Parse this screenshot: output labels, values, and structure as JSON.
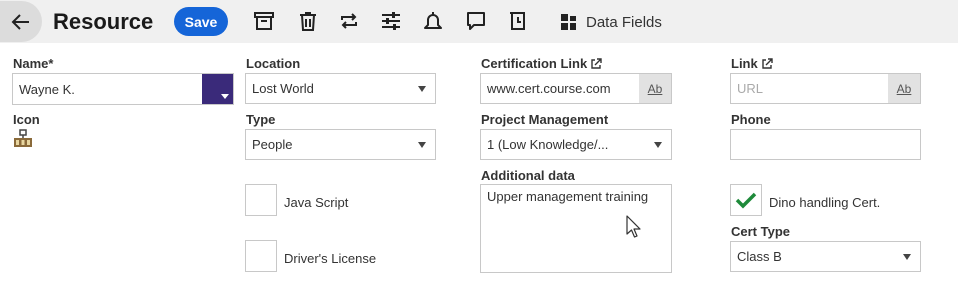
{
  "toolbar": {
    "title": "Resource",
    "save_label": "Save",
    "data_fields_label": "Data Fields"
  },
  "form": {
    "name": {
      "label": "Name*",
      "value": "Wayne K."
    },
    "icon": {
      "label": "Icon"
    },
    "location": {
      "label": "Location",
      "value": "Lost World"
    },
    "type": {
      "label": "Type",
      "value": "People"
    },
    "java_script": {
      "label": "Java Script",
      "checked": false
    },
    "drivers_license": {
      "label": "Driver's License",
      "checked": false
    },
    "certification_link": {
      "label": "Certification Link",
      "value": "www.cert.course.com",
      "ab": "Ab"
    },
    "project_management": {
      "label": "Project Management",
      "value": "1 (Low Knowledge/..."
    },
    "additional_data": {
      "label": "Additional data",
      "value": "Upper management training"
    },
    "link": {
      "label": "Link",
      "placeholder": "URL",
      "ab": "Ab"
    },
    "phone": {
      "label": "Phone",
      "value": ""
    },
    "dino_handling": {
      "label": "Dino handling Cert.",
      "checked": true
    },
    "cert_type": {
      "label": "Cert Type",
      "value": "Class B"
    }
  },
  "colors": {
    "accent": "#1565d8",
    "name_swatch": "#3a2a7a",
    "check": "#1e8a3a"
  }
}
